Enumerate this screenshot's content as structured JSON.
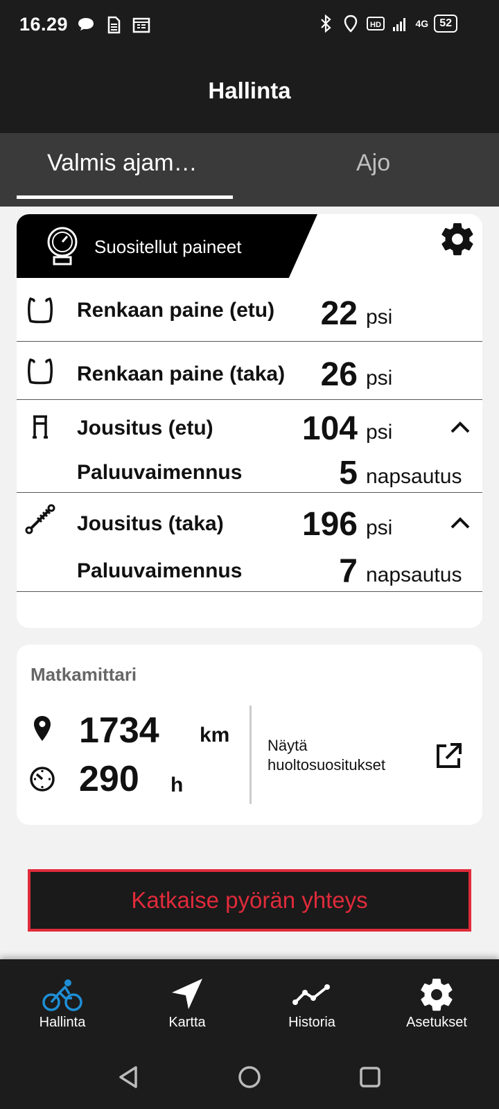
{
  "status_bar": {
    "time": "16.29",
    "battery": "52",
    "network": "4G"
  },
  "header": {
    "title": "Hallinta"
  },
  "tabs": [
    {
      "label": "Valmis ajam…",
      "active": true
    },
    {
      "label": "Ajo",
      "active": false
    }
  ],
  "pressures": {
    "title": "Suositellut paineet",
    "rows": [
      {
        "label": "Renkaan paine (etu)",
        "value": "22",
        "unit": "psi"
      },
      {
        "label": "Renkaan paine (taka)",
        "value": "26",
        "unit": "psi"
      },
      {
        "label": "Jousitus (etu)",
        "value": "104",
        "unit": "psi",
        "sub_label": "Paluuvaimennus",
        "sub_value": "5",
        "sub_unit": "napsautus"
      },
      {
        "label": "Jousitus (taka)",
        "value": "196",
        "unit": "psi",
        "sub_label": "Paluuvaimennus",
        "sub_value": "7",
        "sub_unit": "napsautus"
      }
    ]
  },
  "odometer": {
    "title": "Matkamittari",
    "distance": "1734",
    "distance_unit": "km",
    "time": "290",
    "time_unit": "h",
    "link_line1": "Näytä",
    "link_line2": "huoltosuositukset"
  },
  "disconnect_label": "Katkaise pyörän yhteys",
  "bottom_nav": [
    {
      "label": "Hallinta",
      "icon": "bike-icon",
      "active": true
    },
    {
      "label": "Kartta",
      "icon": "navigation-arrow-icon",
      "active": false
    },
    {
      "label": "Historia",
      "icon": "chart-line-icon",
      "active": false
    },
    {
      "label": "Asetukset",
      "icon": "gear-icon",
      "active": false
    }
  ],
  "colors": {
    "accent": "#1e8fd6",
    "danger": "#e02b3b",
    "bar": "#1c1c1c",
    "tab_bg": "#3a3a3a"
  }
}
